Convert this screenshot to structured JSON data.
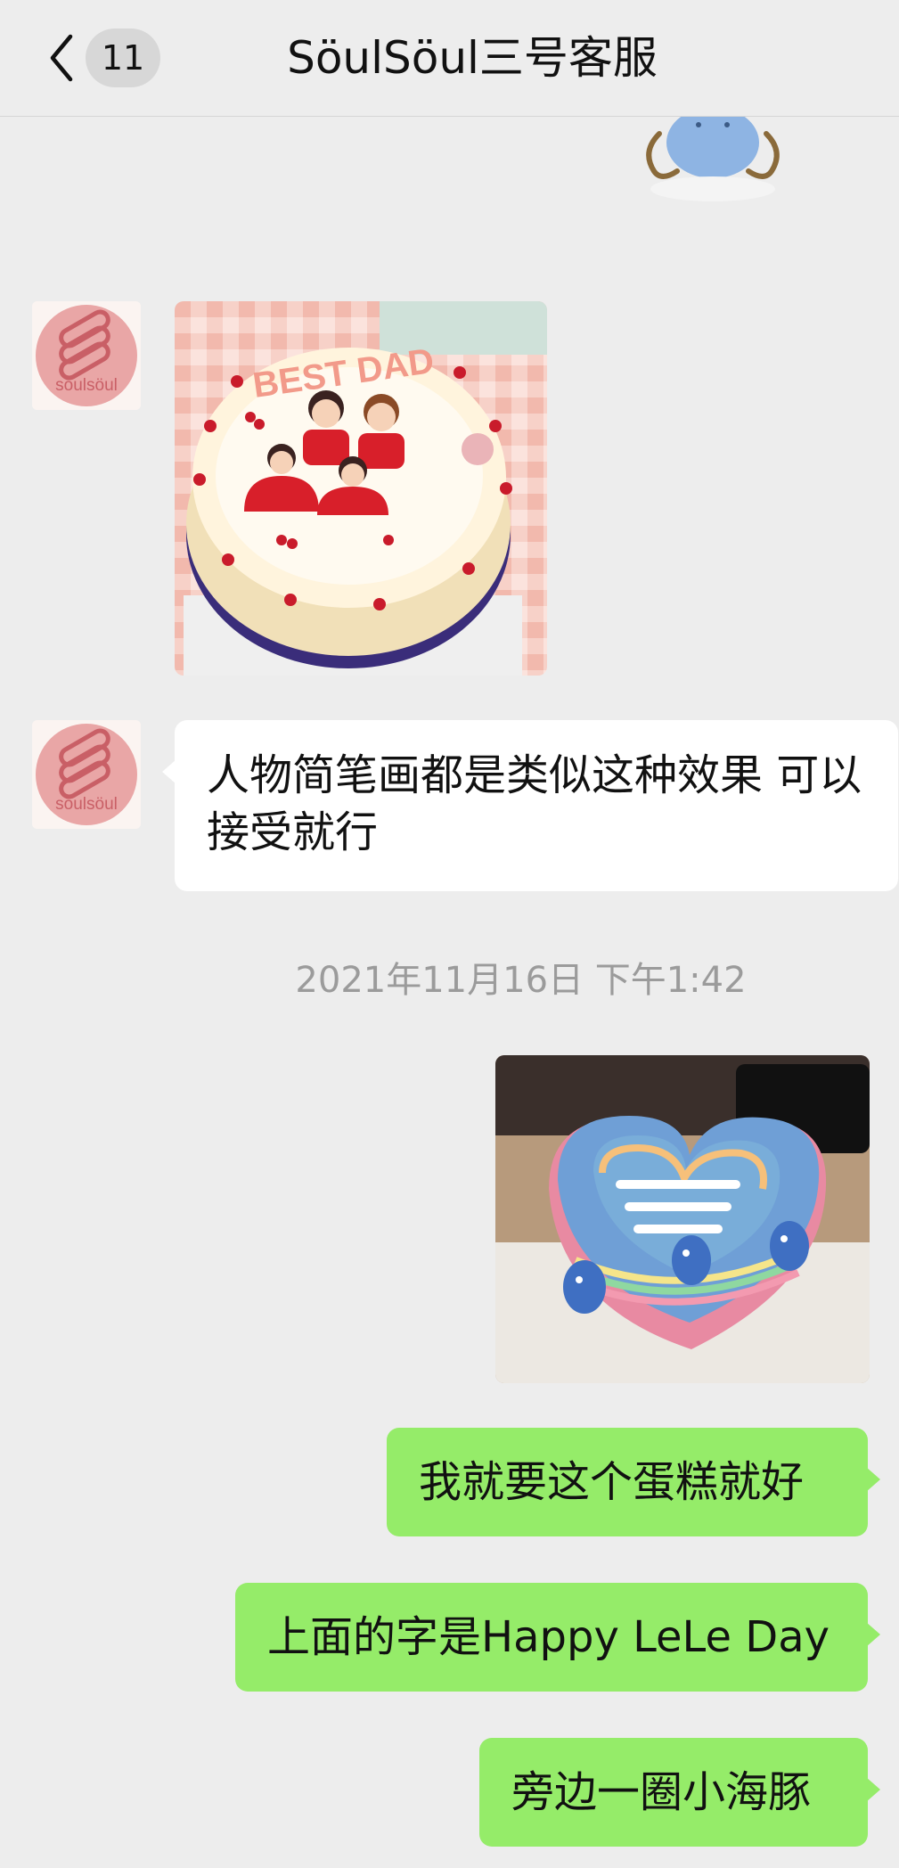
{
  "header": {
    "unread_count": "11",
    "title": "SöulSöul三号客服"
  },
  "contact": {
    "avatar_text": "söulsöul"
  },
  "messages": [
    {
      "type": "sticker",
      "side": "right",
      "icon": "cartoon-sticker"
    },
    {
      "type": "image",
      "side": "left",
      "icon": "cake-photo-best-dad",
      "cake_text": "BEST DAD"
    },
    {
      "type": "text",
      "side": "left",
      "text": "人物简笔画都是类似这种效果 可以接受就行"
    },
    {
      "type": "timestamp",
      "text": "2021年11月16日 下午1:42"
    },
    {
      "type": "image",
      "side": "right",
      "icon": "cake-photo-heart-dolphins"
    },
    {
      "type": "text",
      "side": "right",
      "text": "我就要这个蛋糕就好"
    },
    {
      "type": "text",
      "side": "right",
      "text": "上面的字是Happy LeLe Day"
    },
    {
      "type": "text",
      "side": "right",
      "text": "旁边一圈小海豚"
    }
  ],
  "colors": {
    "background": "#ededed",
    "incoming_bubble": "#ffffff",
    "outgoing_bubble": "#95ec69",
    "timestamp": "#9b9b9b"
  }
}
